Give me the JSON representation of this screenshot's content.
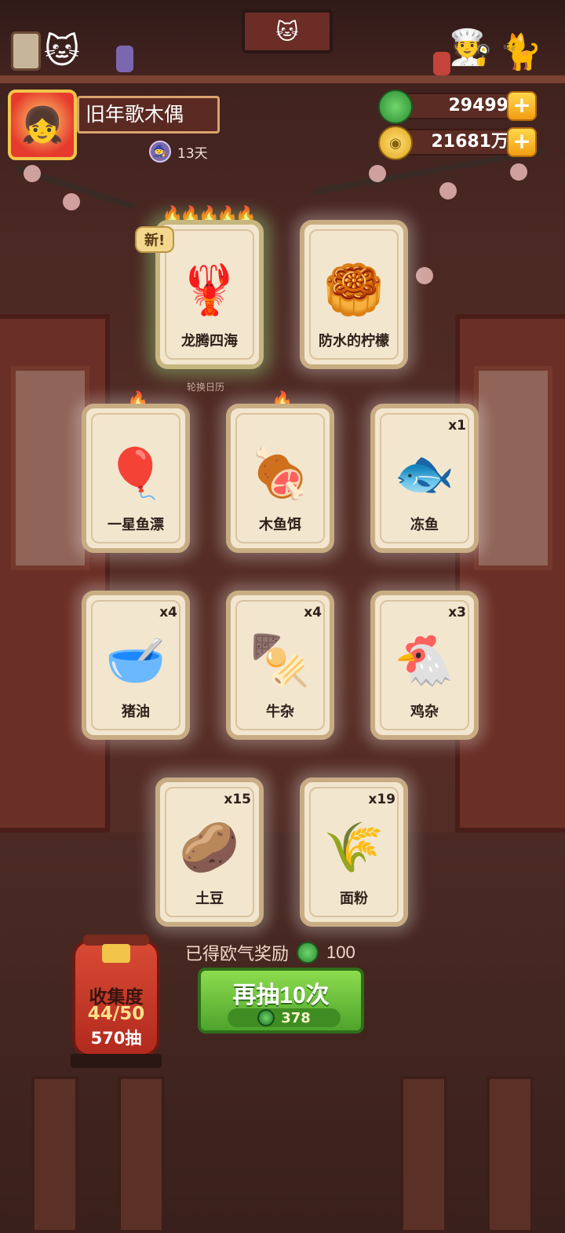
{
  "player": {
    "name": "旧年歌木偶",
    "days": "13天"
  },
  "currency": {
    "jade": "29499",
    "gold": "21681万"
  },
  "cards": [
    {
      "label": "龙腾四海",
      "count": "",
      "icon": "dragon-feast",
      "badge": "新!"
    },
    {
      "label": "防水的柠檬",
      "count": "",
      "icon": "triangle-cookie"
    },
    {
      "label": "一星鱼漂",
      "count": "",
      "icon": "fishing-float"
    },
    {
      "label": "木鱼饵",
      "count": "",
      "icon": "wood-bait"
    },
    {
      "label": "冻鱼",
      "count": "x1",
      "icon": "frozen-fish"
    },
    {
      "label": "猪油",
      "count": "x4",
      "icon": "lard"
    },
    {
      "label": "牛杂",
      "count": "x4",
      "icon": "beef-offal"
    },
    {
      "label": "鸡杂",
      "count": "x3",
      "icon": "chicken-offal"
    },
    {
      "label": "土豆",
      "count": "x15",
      "icon": "potato"
    },
    {
      "label": "面粉",
      "count": "x19",
      "icon": "flour"
    }
  ],
  "rotate_label": "轮换日历",
  "reward": {
    "text": "已得欧气奖励",
    "value": "100"
  },
  "draw_button": {
    "title": "再抽10次",
    "cost": "378"
  },
  "collection": {
    "title": "收集度",
    "progress": "44/50",
    "draws": "570抽"
  }
}
